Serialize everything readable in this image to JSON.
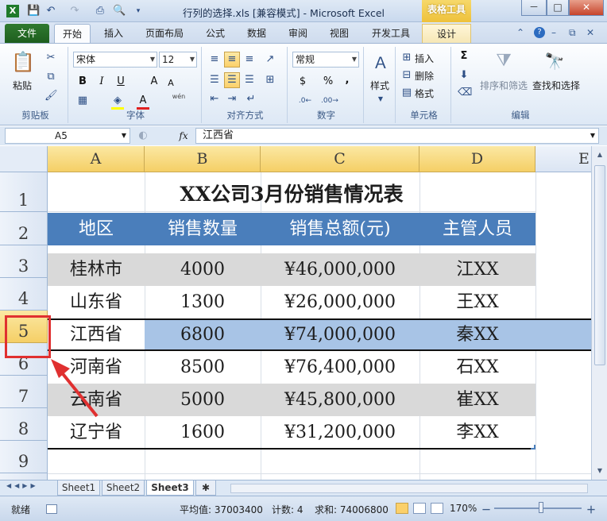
{
  "window": {
    "title": "行列的选择.xls  [兼容模式] - Microsoft Excel",
    "context_tab": "表格工具",
    "min": "－",
    "max": "□",
    "close": "✕"
  },
  "tabs": {
    "file": "文件",
    "items": [
      "开始",
      "插入",
      "页面布局",
      "公式",
      "数据",
      "审阅",
      "视图",
      "开发工具"
    ],
    "design": "设计"
  },
  "ribbon": {
    "clipboard": {
      "paste": "粘贴",
      "label": "剪贴板"
    },
    "font": {
      "name": "宋体",
      "size": "12",
      "bold": "B",
      "italic": "I",
      "underline": "U",
      "label": "字体",
      "grow": "A",
      "shrink": "A",
      "wen": "wén"
    },
    "alignment": {
      "label": "对齐方式"
    },
    "number": {
      "format": "常规",
      "currency": "$",
      "percent": "%",
      "comma": ",",
      "label": "数字"
    },
    "styles": {
      "label": "样式"
    },
    "cells": {
      "insert": "插入",
      "delete": "删除",
      "format": "格式",
      "label": "单元格"
    },
    "editing": {
      "sort": "排序和筛选",
      "find": "查找和选择",
      "label": "编辑",
      "sum": "Σ"
    }
  },
  "formula_bar": {
    "name_box": "A5",
    "fx": "fx",
    "value": "江西省"
  },
  "columns": [
    "A",
    "B",
    "C",
    "D",
    "E"
  ],
  "rows": [
    "1",
    "2",
    "3",
    "4",
    "5",
    "6",
    "7",
    "8",
    "9"
  ],
  "table": {
    "title": "XX公司3月份销售情况表",
    "headers": [
      "地区",
      "销售数量",
      "销售总额(元)",
      "主管人员"
    ],
    "data": [
      [
        "桂林市",
        "4000",
        "¥46,000,000",
        "江XX"
      ],
      [
        "山东省",
        "1300",
        "¥26,000,000",
        "王XX"
      ],
      [
        "江西省",
        "6800",
        "¥74,000,000",
        "秦XX"
      ],
      [
        "河南省",
        "8500",
        "¥76,400,000",
        "石XX"
      ],
      [
        "云南省",
        "5000",
        "¥45,800,000",
        "崔XX"
      ],
      [
        "辽宁省",
        "1600",
        "¥31,200,000",
        "李XX"
      ]
    ]
  },
  "sheets": [
    "Sheet1",
    "Sheet2",
    "Sheet3"
  ],
  "status": {
    "ready": "就绪",
    "average": "平均值: 37003400",
    "count": "计数: 4",
    "sum": "求和: 74006800",
    "zoom": "170%"
  },
  "colors": {
    "header_blue": "#4a7ebb",
    "stripe_gray": "#d9d9d9",
    "selected_row": "#a8c4e6",
    "annotation_red": "#e03030"
  }
}
